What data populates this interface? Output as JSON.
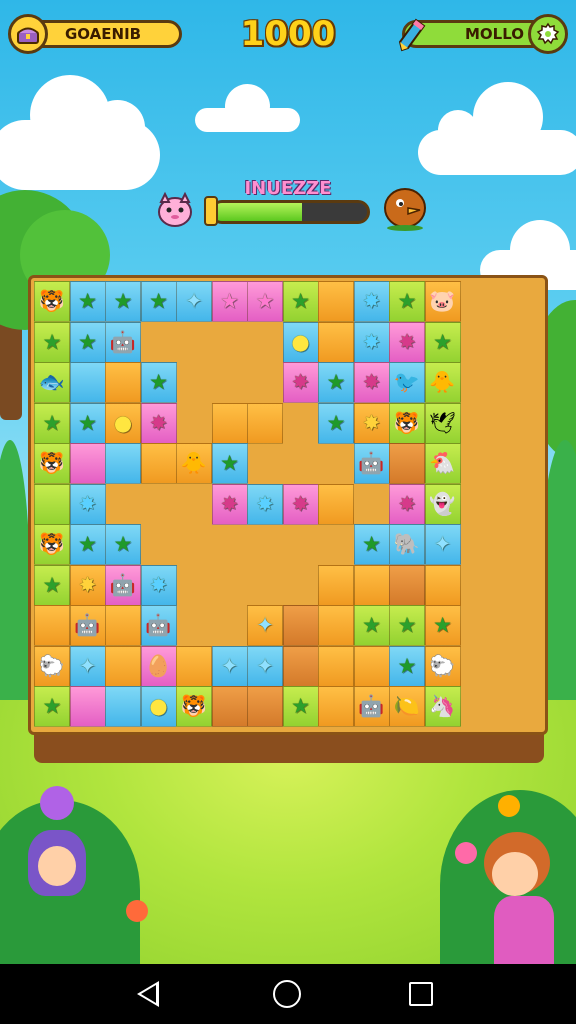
{
  "hud": {
    "left_label": "GOAENIB",
    "left_icon": "treasure-chest-icon",
    "score": "1000",
    "right_label": "MOLLO",
    "right_icon": "pencil-icon",
    "settings_icon": "gear-icon"
  },
  "level": {
    "title": "INUEZZE",
    "progress": 0.58,
    "left_character": "pink-creature-icon",
    "right_character": "brown-bird-icon"
  },
  "colors": {
    "green": "#93d231",
    "blue": "#44b6ea",
    "orange": "#f09a21",
    "pink": "#e45fc4",
    "dirt": "#d47a2a",
    "hud_yellow": "#ffd21a"
  },
  "board": {
    "rows": [
      [
        "g:🐯",
        "b:★",
        "b:★",
        "b:★",
        "b:✦",
        "p:★",
        "p:★",
        "g:★",
        "o:",
        "b:✸",
        "g:★",
        "o:🐷"
      ],
      [
        "g:★",
        "b:★",
        "b:🤖",
        "x:",
        "x:",
        "x:",
        "x:",
        "b:●",
        "o:",
        "b:✸",
        "p:✸",
        "g:★"
      ],
      [
        "g:🐟",
        "b:",
        "o:",
        "b:★",
        "x:",
        "x:",
        "x:",
        "p:✸",
        "b:★",
        "p:✸",
        "b:🐦",
        "g:🐥"
      ],
      [
        "g:★",
        "b:★",
        "o:●",
        "p:✸",
        "x:",
        "o:",
        "o:",
        "x:",
        "b:★",
        "o:✸",
        "g:🐯",
        "g:🕊"
      ],
      [
        "g:🐯",
        "p:",
        "b:",
        "o:",
        "🐥",
        "b:★",
        "x:",
        "x:",
        "x:",
        "b:🤖",
        "d:",
        "g:🐔"
      ],
      [
        "g:",
        "b:✸",
        "x:",
        "x:",
        "x:",
        "p:✸",
        "b:✸",
        "p:✸",
        "o:",
        "x:",
        "p:✸",
        "g:👻"
      ],
      [
        "g:🐯",
        "b:★",
        "b:★",
        "x:",
        "x:",
        "x:",
        "x:",
        "x:",
        "x:",
        "b:★",
        "b:🐘",
        "b:✦"
      ],
      [
        "g:★",
        "o:✸",
        "p:🤖",
        "b:✸",
        "x:",
        "x:",
        "x:",
        "x:",
        "o:",
        "o:",
        "d:",
        "o:"
      ],
      [
        "o:",
        "o:🤖",
        "o:",
        "b:🤖",
        "x:",
        "x:",
        "o:✦",
        "d:",
        "o:",
        "g:★",
        "g:★",
        "o:★"
      ],
      [
        "o:🐑",
        "b:✦",
        "o:",
        "p:🥚",
        "o:",
        "b:✦",
        "b:✦",
        "d:",
        "o:",
        "o:",
        "b:★",
        "o:🐑"
      ],
      [
        "g:★",
        "p:",
        "b:",
        "b:●",
        "g:🐯",
        "d:",
        "d:",
        "g:★",
        "o:",
        "o:🤖",
        "o:🍋",
        "g:🦄"
      ]
    ]
  },
  "nav": {
    "back_icon": "back-triangle-icon",
    "home_icon": "home-circle-icon",
    "recent_icon": "recent-square-icon"
  }
}
